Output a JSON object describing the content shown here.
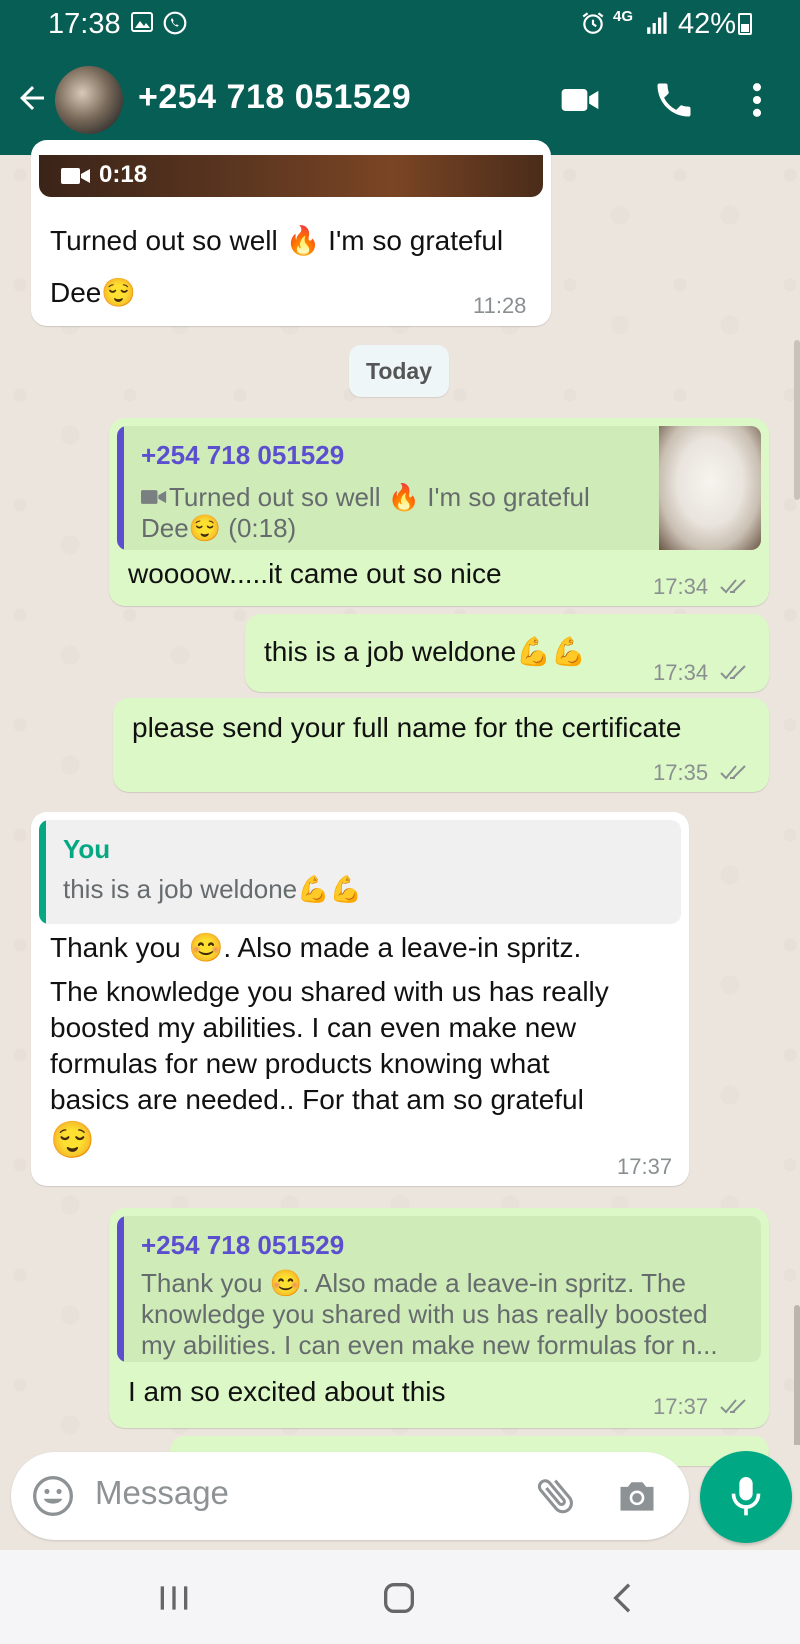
{
  "status_bar": {
    "time": "17:38",
    "network": "4G",
    "battery": "42%",
    "icons": [
      "gallery-icon",
      "whatsapp-icon",
      "alarm-icon",
      "signal-icon",
      "battery-icon"
    ]
  },
  "header": {
    "contact_name": "+254 718 051529",
    "icons": [
      "back-arrow-icon",
      "video-call-icon",
      "voice-call-icon",
      "more-vert-icon"
    ],
    "bg_color": "#075e54"
  },
  "messages": [
    {
      "direction": "incoming",
      "video_duration": "0:18",
      "text": "Turned out so well 🔥 I'm so grateful Dee😌",
      "time": "11:28"
    },
    {
      "type": "date_chip",
      "text": "Today"
    },
    {
      "direction": "outgoing",
      "quote": {
        "author": "+254 718 051529",
        "text_line1": "Turned out so well 🔥 I'm so grateful",
        "text_line2": "Dee😌 (0:18)",
        "icon": "video-icon"
      },
      "text": "woooow.....it came out so nice",
      "time": "17:34",
      "status": "read"
    },
    {
      "direction": "outgoing",
      "text": "this is a job weldone💪💪",
      "time": "17:34",
      "status": "read"
    },
    {
      "direction": "outgoing",
      "text": "please send your full name for the certificate",
      "time": "17:35",
      "status": "read"
    },
    {
      "direction": "incoming",
      "quote": {
        "author": "You",
        "text": "this is a job weldone💪💪"
      },
      "text_line1": "Thank you 😊. Also made a leave-in spritz.",
      "text_lines": [
        "The knowledge you shared with us has really",
        "boosted my abilities. I can even make new",
        "formulas for new products knowing what",
        "basics are needed.. For that am so grateful",
        "😌"
      ],
      "time": "17:37"
    },
    {
      "direction": "outgoing",
      "quote": {
        "author": "+254 718 051529",
        "lines": [
          "Thank you 😊. Also made a leave-in spritz. The",
          "knowledge you shared with us has really boosted",
          "my abilities. I can even make new formulas for n..."
        ]
      },
      "text": "I am so excited about this",
      "time": "17:37",
      "status": "read"
    }
  ],
  "composer": {
    "placeholder": "Message",
    "icons": [
      "emoji-icon",
      "attach-icon",
      "camera-icon",
      "mic-icon"
    ],
    "accent": "#00a884"
  },
  "nav_bar": {
    "icons": [
      "recent-apps-icon",
      "home-icon",
      "back-icon"
    ]
  },
  "colors": {
    "incoming": "#ffffff",
    "outgoing": "#dcf8c6",
    "quote_bar_outgoing": "#5b4fd0",
    "quote_bar_incoming": "#06a884",
    "chat_bg": "#ece5dd"
  }
}
